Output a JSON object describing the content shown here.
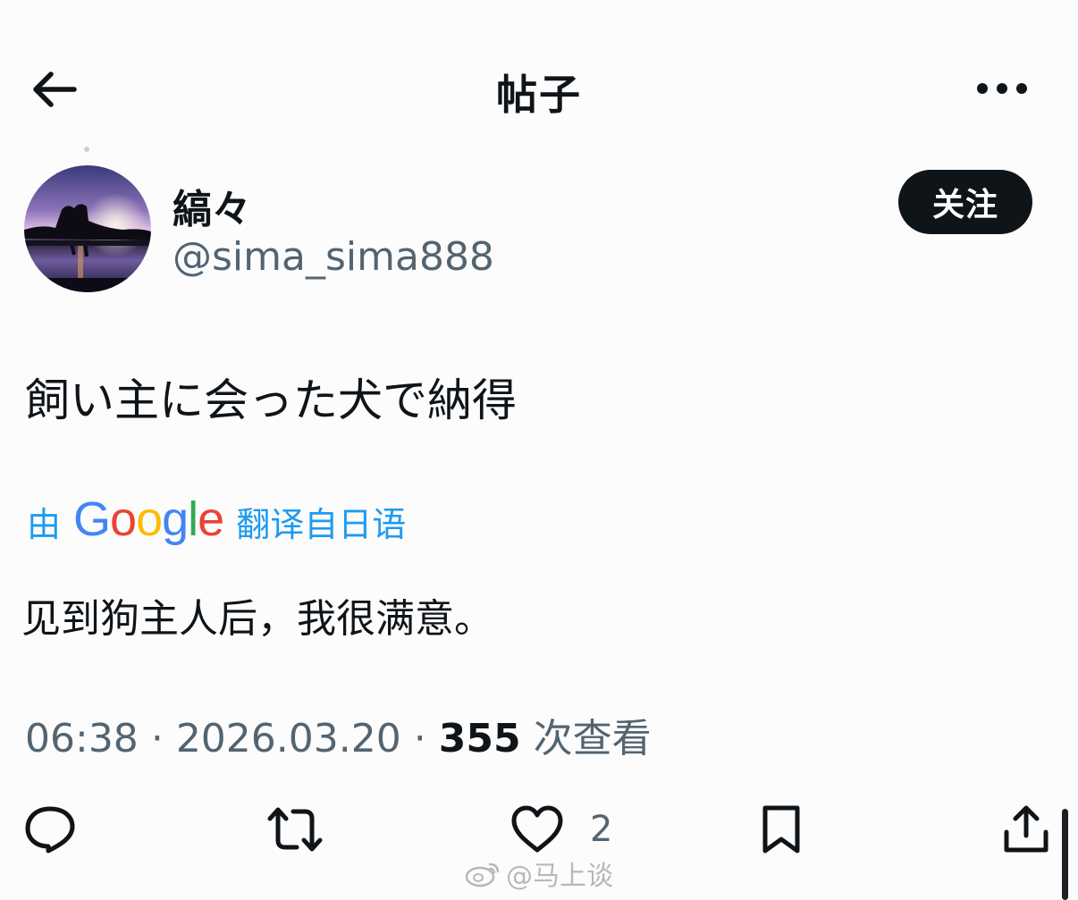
{
  "header": {
    "title": "帖子",
    "back_icon": "arrow-left-icon",
    "more_icon": "more-horizontal-icon"
  },
  "author": {
    "display_name": "縞々",
    "handle": "@sima_sima888",
    "follow_label": "关注"
  },
  "post": {
    "text": "飼い主に会った犬で納得",
    "translate_prefix": "由",
    "translate_brand": [
      "G",
      "o",
      "o",
      "g",
      "l",
      "e"
    ],
    "translate_brand_colors": [
      "#4285F4",
      "#EA4335",
      "#FBBC05",
      "#4285F4",
      "#34A853",
      "#EA4335"
    ],
    "translate_suffix": "翻译自日语",
    "translation": "见到狗主人后，我很满意。"
  },
  "meta": {
    "time": "06:38",
    "sep": "·",
    "date": "2026.03.20",
    "views": "355",
    "views_label": "次查看"
  },
  "actions": {
    "like_count": "2"
  },
  "watermark": {
    "text": "@马上谈"
  },
  "colors": {
    "accent": "#1d9bf0",
    "text": "#0f1419",
    "secondary": "#536471"
  }
}
